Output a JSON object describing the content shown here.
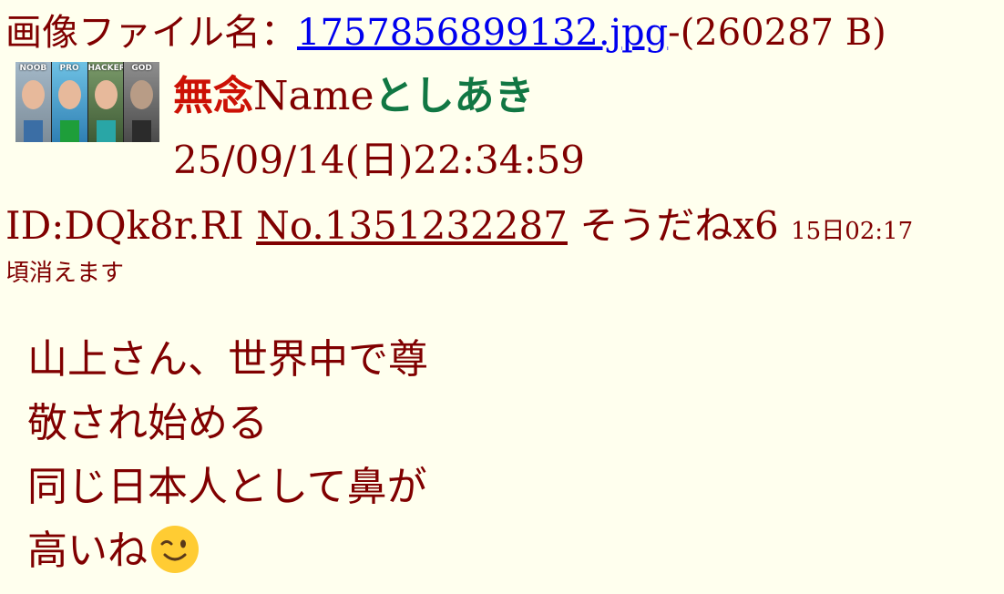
{
  "file": {
    "label": "画像ファイル名：",
    "filename": "1757856899132.jpg",
    "size": "-(260287 B)"
  },
  "thumbnail": {
    "panels": [
      "NOOB",
      "PRO",
      "HACKER",
      "GOD"
    ]
  },
  "post": {
    "subject": "無念",
    "name_label": "Name",
    "poster": "としあき",
    "date": "25/09/14(日)22:34:59",
    "id": "ID:DQk8r.RI",
    "number": "No.1351232287",
    "sodane": "そうだねx6",
    "expire_time": "15日02:17",
    "expire_note": "頃消えます",
    "comment_lines": [
      "山上さん、世界中で尊",
      "敬され始める",
      "同じ日本人として鼻が",
      "高いね"
    ],
    "emoji": "winking-face"
  },
  "colors": {
    "background": "#ffffee",
    "text": "#800000",
    "subject": "#cc1105",
    "poster": "#117743",
    "link": "#0000ee"
  }
}
